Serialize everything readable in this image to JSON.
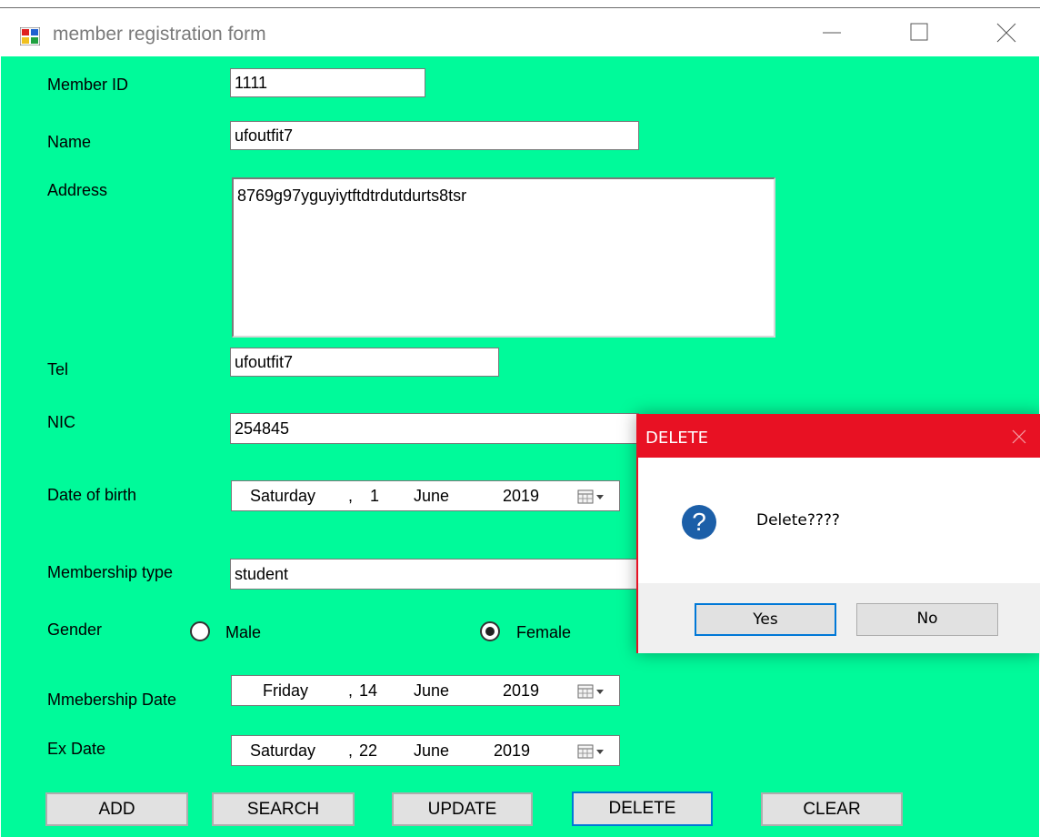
{
  "window": {
    "title": "member registration form"
  },
  "form": {
    "member_id_label": "Member ID",
    "member_id_value": "1111",
    "name_label": "Name",
    "name_value": "ufoutfit7",
    "address_label": "Address",
    "address_value": "8769g97yguyiytftdtrdutdurts8tsr",
    "tel_label": "Tel",
    "tel_value": "ufoutfit7",
    "nic_label": "NIC",
    "nic_value": "254845",
    "dob_label": "Date of birth",
    "dob": {
      "day": "Saturday",
      "sep": ",",
      "date": "1",
      "month": "June",
      "year": "2019"
    },
    "membership_type_label": "Membership type",
    "membership_type_value": "student",
    "gender_label": "Gender",
    "gender_male": "Male",
    "gender_female": "Female",
    "gender_selected": "Female",
    "membership_date_label": "Mmebership Date",
    "membership_date": {
      "day": "Friday",
      "sep": ",",
      "date": "14",
      "month": "June",
      "year": "2019"
    },
    "ex_date_label": "Ex Date",
    "ex_date": {
      "day": "Saturday",
      "sep": ",",
      "date": "22",
      "month": "June",
      "year": "2019"
    }
  },
  "buttons": {
    "add": "ADD",
    "search": "SEARCH",
    "update": "UPDATE",
    "delete": "DELETE",
    "clear": "CLEAR"
  },
  "dialog": {
    "title": "DELETE",
    "message": "Delete????",
    "icon": "question-icon",
    "yes": "Yes",
    "no": "No",
    "accent": "#e81123"
  },
  "colors": {
    "client_bg": "#00fa9a",
    "focus": "#0078d7"
  }
}
